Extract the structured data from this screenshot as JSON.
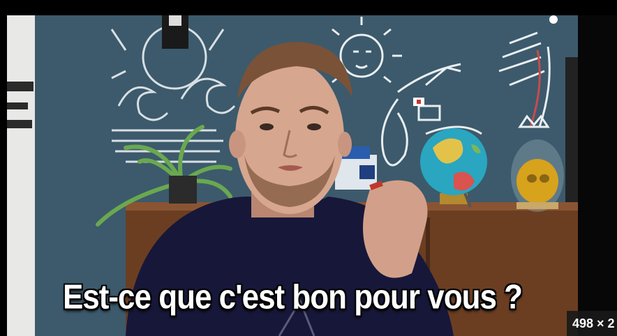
{
  "video": {
    "caption": "Est-ce que c'est bon pour vous ?",
    "size_label": "498 × 2"
  },
  "colors": {
    "wall": "#3c5a6c",
    "hoodie": "#17173a",
    "skin": "#d6a68f",
    "globe_ocean": "#2aa6c0",
    "skull_gold": "#d7a21c"
  }
}
